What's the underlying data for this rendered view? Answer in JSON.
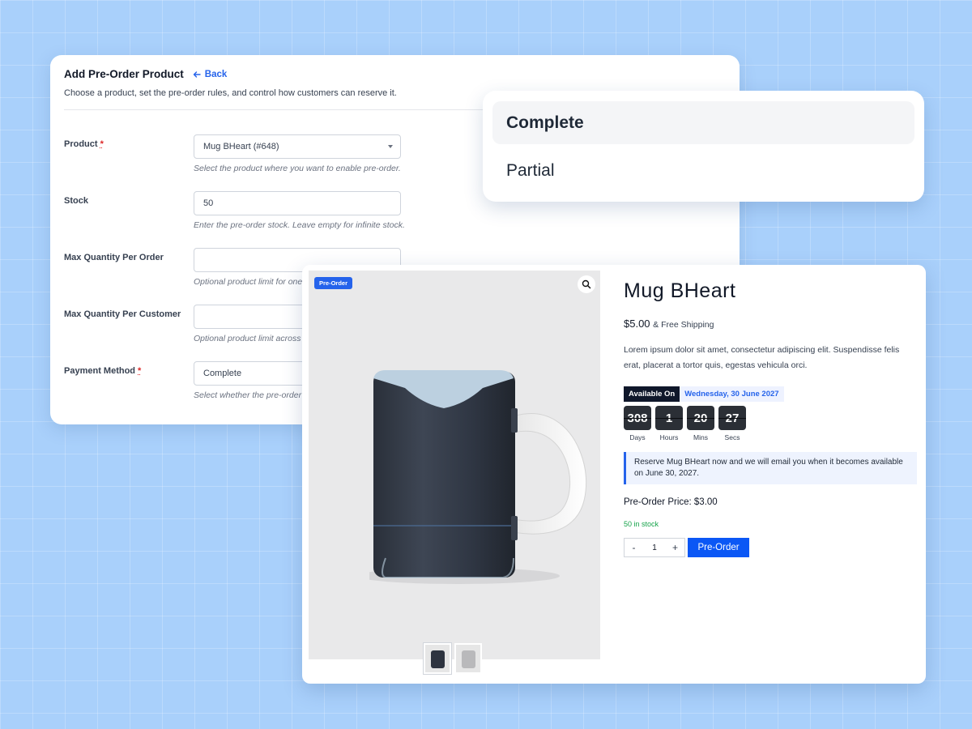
{
  "admin": {
    "title": "Add Pre-Order Product",
    "back_label": "Back",
    "description": "Choose a product, set the pre-order rules, and control how customers can reserve it.",
    "required_marker": "*",
    "fields": {
      "product": {
        "label": "Product",
        "value": "Mug BHeart (#648)",
        "help": "Select the product where you want to enable pre-order."
      },
      "stock": {
        "label": "Stock",
        "value": "50",
        "help": "Enter the pre-order stock. Leave empty for infinite stock."
      },
      "max_per_order": {
        "label": "Max Quantity Per Order",
        "value": "",
        "help": "Optional product limit for one order."
      },
      "max_per_customer": {
        "label": "Max Quantity Per Customer",
        "value": "",
        "help": "Optional product limit across all orders."
      },
      "payment_method": {
        "label": "Payment Method",
        "value": "Complete",
        "help": "Select whether the pre-order payment is complete or partial."
      }
    }
  },
  "dropdown": {
    "options": [
      "Complete",
      "Partial"
    ],
    "selected": "Complete"
  },
  "product": {
    "badge": "Pre-Order",
    "title": "Mug BHeart",
    "price": "$5.00",
    "shipping": "& Free Shipping",
    "description": "Lorem ipsum dolor sit amet, consectetur adipiscing elit. Suspendisse felis erat, placerat a tortor quis, egestas vehicula orci.",
    "available_label": "Available On",
    "available_date": "Wednesday, 30 June 2027",
    "countdown": [
      {
        "value": "308",
        "label": "Days"
      },
      {
        "value": "1",
        "label": "Hours"
      },
      {
        "value": "20",
        "label": "Mins"
      },
      {
        "value": "27",
        "label": "Secs"
      }
    ],
    "notice": "Reserve Mug BHeart now and we will email you when it becomes available on June 30, 2027.",
    "preorder_price": "Pre-Order Price: $3.00",
    "stock_status": "50 in stock",
    "quantity": "1",
    "qty_minus": "-",
    "qty_plus": "+",
    "button_label": "Pre-Order"
  },
  "colors": {
    "accent": "#2563eb",
    "button": "#0b57f5",
    "in_stock": "#16a34a",
    "required": "#dc2626"
  },
  "icons": [
    "arrow-left-icon",
    "chevron-down-icon",
    "zoom-icon"
  ]
}
